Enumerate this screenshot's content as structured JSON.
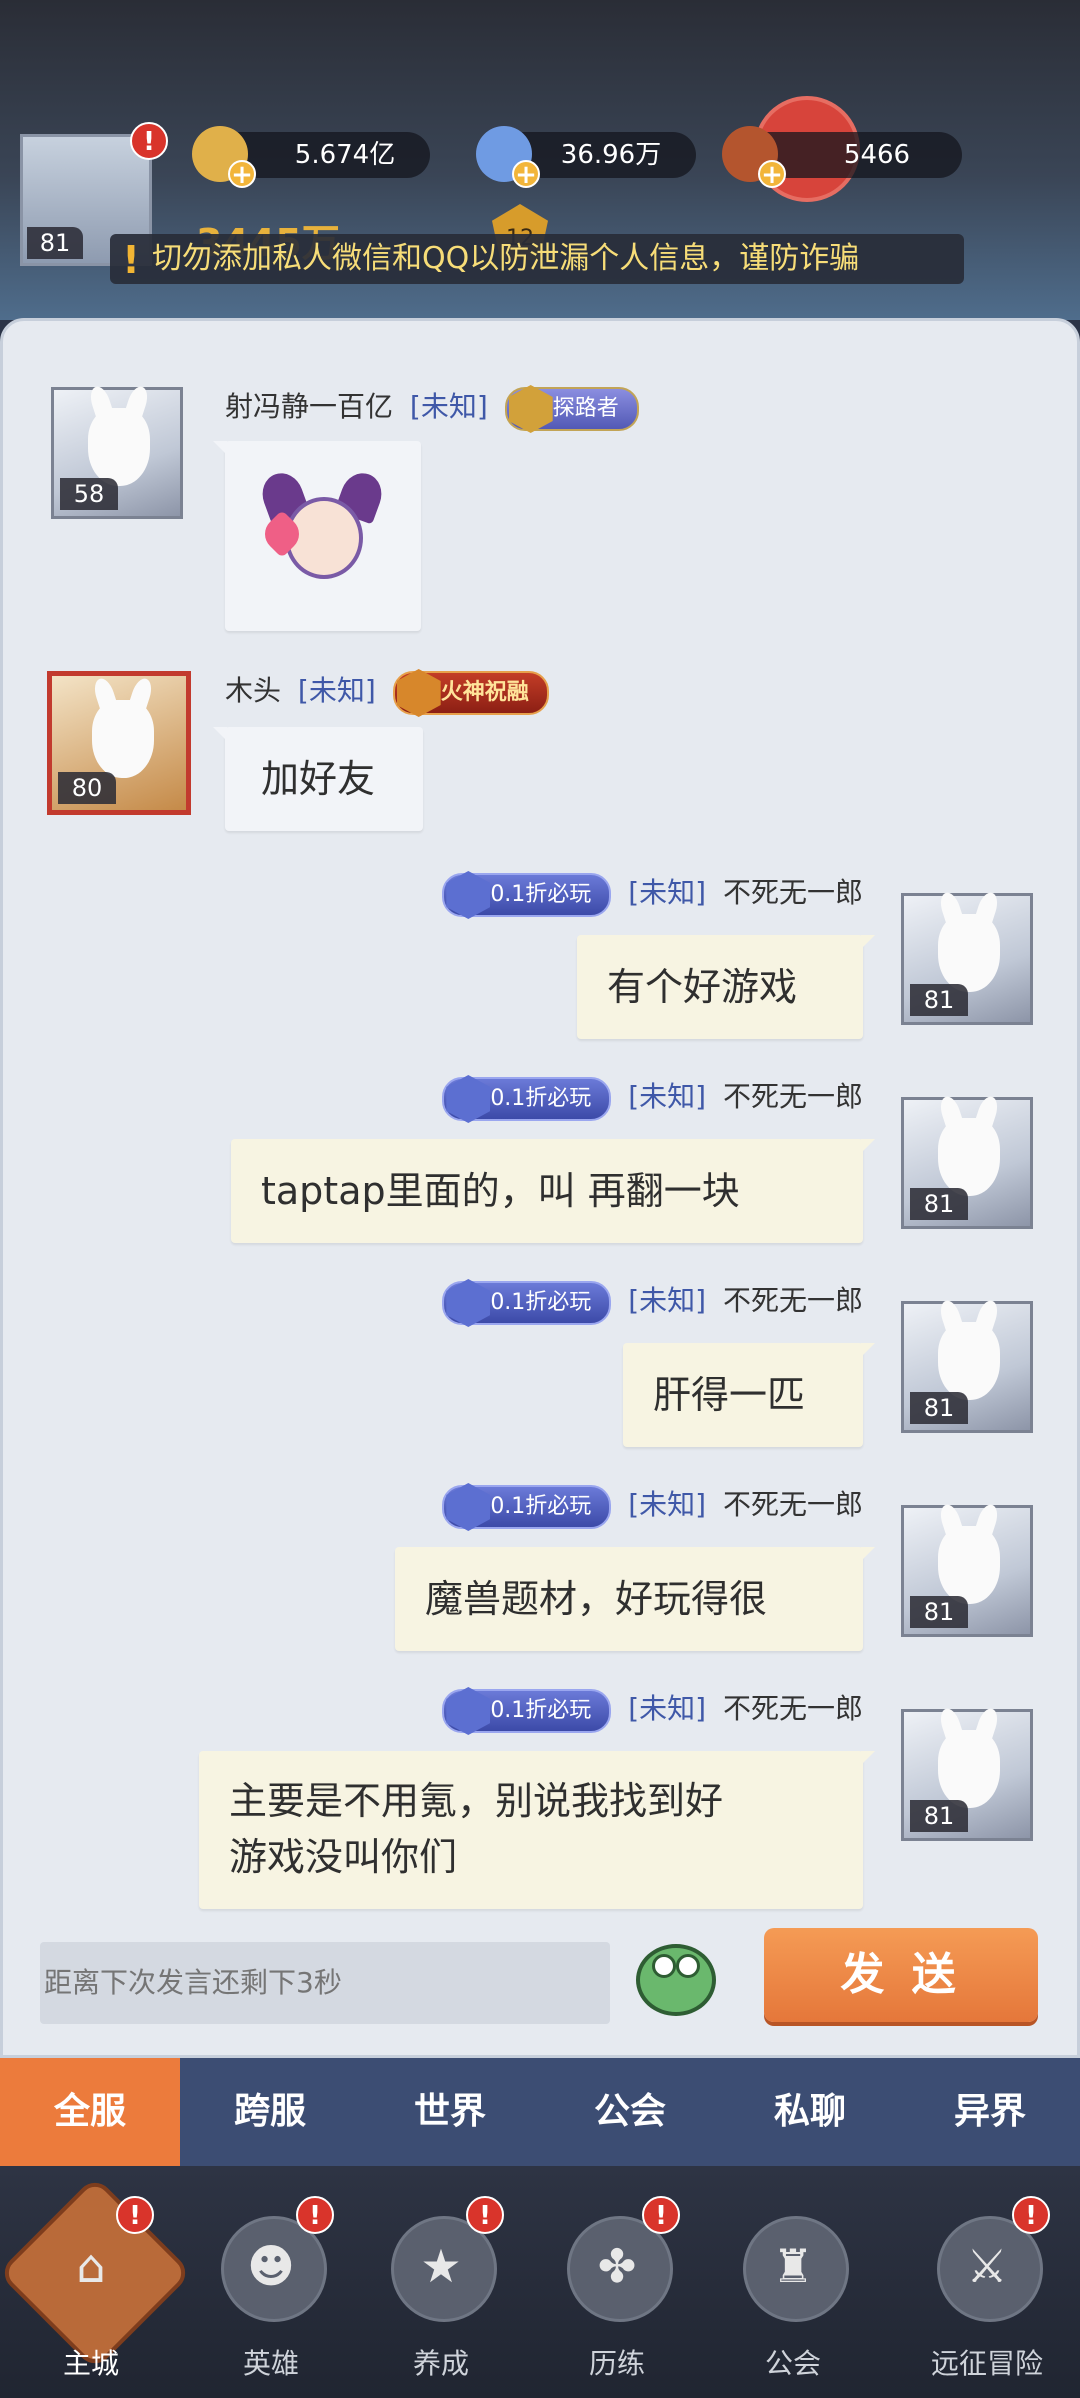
{
  "header": {
    "player_level": "81",
    "resources": [
      {
        "name": "gold",
        "value": "5.674亿",
        "icon": "gold-coin-icon",
        "color": "#e0b04a"
      },
      {
        "name": "diamond",
        "value": "36.96万",
        "icon": "diamond-icon",
        "color": "#6f9be3"
      },
      {
        "name": "ticket",
        "value": "5466",
        "icon": "ticket-icon",
        "color": "#b4552e"
      }
    ],
    "combat_power": "3445万",
    "crest_level": "12",
    "notice_icon": "exclamation-icon",
    "notice": "切勿添加私人微信和QQ以防泄漏个人信息，谨防诈骗"
  },
  "chat": {
    "messages": [
      {
        "side": "left",
        "name": "射冯静一百亿",
        "tag": "[未知]",
        "title": "探路者",
        "level": "58",
        "type": "sticker",
        "text": ""
      },
      {
        "side": "left",
        "name": "木头",
        "tag": "[未知]",
        "title": "火神祝融",
        "level": "80",
        "type": "text",
        "text": "加好友"
      },
      {
        "side": "right",
        "name": "不死无一郎",
        "tag": "[未知]",
        "title": "0.1折必玩",
        "level": "81",
        "type": "text",
        "text": "有个好游戏"
      },
      {
        "side": "right",
        "name": "不死无一郎",
        "tag": "[未知]",
        "title": "0.1折必玩",
        "level": "81",
        "type": "text",
        "text": "taptap里面的，叫 再翻一块"
      },
      {
        "side": "right",
        "name": "不死无一郎",
        "tag": "[未知]",
        "title": "0.1折必玩",
        "level": "81",
        "type": "text",
        "text": "肝得一匹"
      },
      {
        "side": "right",
        "name": "不死无一郎",
        "tag": "[未知]",
        "title": "0.1折必玩",
        "level": "81",
        "type": "text",
        "text": "魔兽题材，好玩得很"
      },
      {
        "side": "right",
        "name": "不死无一郎",
        "tag": "[未知]",
        "title": "0.1折必玩",
        "level": "81",
        "type": "text",
        "text": "主要是不用氪，别说我找到好",
        "text2": "游戏没叫你们"
      }
    ]
  },
  "input": {
    "placeholder": "距离下次发言还剩下3秒",
    "send_label": "发 送"
  },
  "tabs": [
    "全服",
    "跨服",
    "世界",
    "公会",
    "私聊",
    "异界"
  ],
  "active_tab": "全服",
  "nav": [
    {
      "label": "主城",
      "icon": "castle-icon",
      "glyph": "⌂"
    },
    {
      "label": "英雄",
      "icon": "hero-mask-icon",
      "glyph": "☻"
    },
    {
      "label": "养成",
      "icon": "star-icon",
      "glyph": "★"
    },
    {
      "label": "历练",
      "icon": "grid-icon",
      "glyph": "✤"
    },
    {
      "label": "公会",
      "icon": "guild-tower-icon",
      "glyph": "♜"
    },
    {
      "label": "远征冒险",
      "icon": "crossed-swords-icon",
      "glyph": "⚔"
    }
  ],
  "red_dot": "!"
}
